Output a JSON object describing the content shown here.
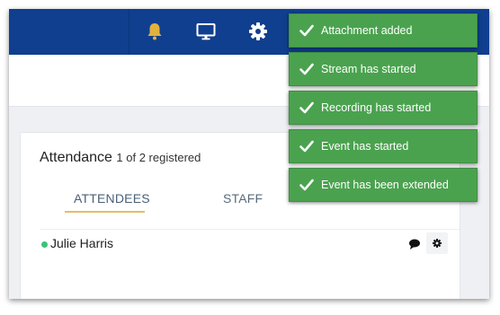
{
  "topbar": {
    "icons": [
      "bell-icon",
      "monitor-icon",
      "gear-icon"
    ],
    "bell_color": "#e3b23c",
    "background": "#103f8f"
  },
  "attendance": {
    "title": "Attendance",
    "count_text": "1 of 2 registered",
    "tabs": [
      {
        "label": "ATTENDEES",
        "active": true
      },
      {
        "label": "STAFF",
        "active": false
      }
    ],
    "attendees": [
      {
        "name": "Julie Harris",
        "status": "online"
      }
    ]
  },
  "notifications": [
    {
      "text": "Attachment added"
    },
    {
      "text": "Stream has started"
    },
    {
      "text": "Recording has started"
    },
    {
      "text": "Event has started"
    },
    {
      "text": "Event has been extended"
    }
  ],
  "colors": {
    "toast_green": "#4aa24e",
    "online_green": "#3cc37a",
    "active_tab_underline": "#e0c066"
  }
}
